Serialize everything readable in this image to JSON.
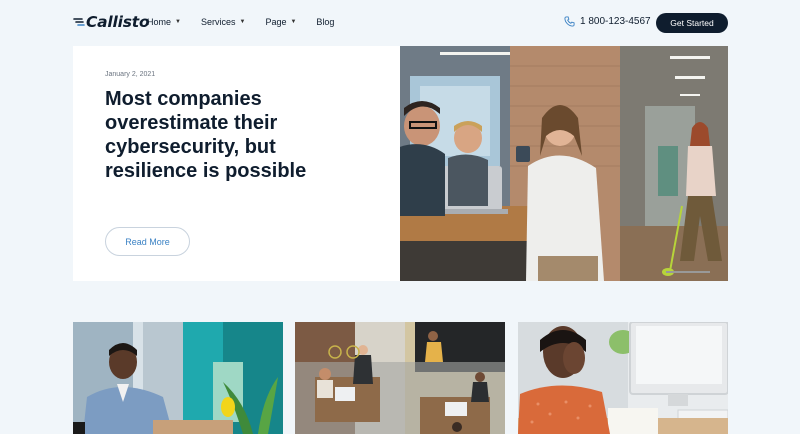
{
  "header": {
    "logo_text": "Callisto",
    "nav": [
      {
        "label": "Home",
        "has_dropdown": true
      },
      {
        "label": "Services",
        "has_dropdown": true
      },
      {
        "label": "Page",
        "has_dropdown": true
      },
      {
        "label": "Blog",
        "has_dropdown": false
      }
    ],
    "phone": "1 800-123-4567",
    "cta_label": "Get Started"
  },
  "hero": {
    "date": "January 2, 2021",
    "title": "Most companies overestimate their cybersecurity, but resilience is possible",
    "read_more_label": "Read More",
    "image_icon": "team-meeting-photo"
  },
  "cards": [
    {
      "image_icon": "businessman-at-desk-photo"
    },
    {
      "image_icon": "office-overhead-photo"
    },
    {
      "image_icon": "woman-at-computer-photo"
    }
  ],
  "colors": {
    "background": "#f1f6fa",
    "navy": "#0f1d2e",
    "accent_link": "#3b82c4"
  }
}
